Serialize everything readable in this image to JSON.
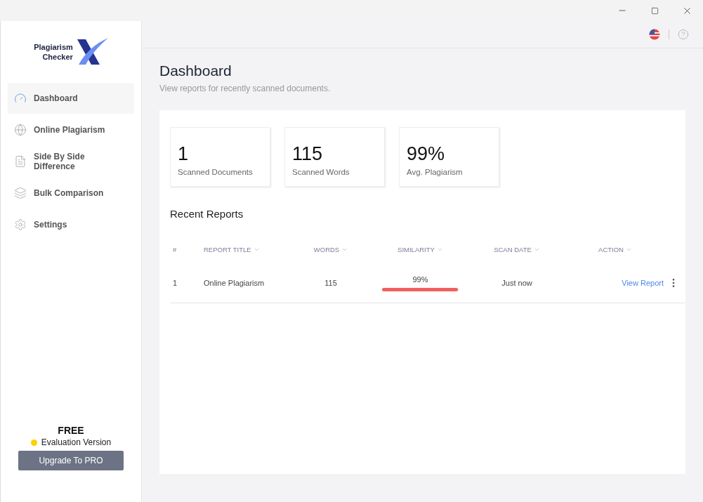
{
  "logo": {
    "line_1": "Plagiarism",
    "line_2": "Checker"
  },
  "sidebar": {
    "items": [
      {
        "label": "Dashboard",
        "kind": "gauge",
        "selected": true
      },
      {
        "label": "Online Plagiarism",
        "kind": "globe",
        "selected": false
      },
      {
        "label": "Side By Side Difference",
        "kind": "document",
        "selected": false
      },
      {
        "label": "Bulk Comparison",
        "kind": "layers",
        "selected": false
      },
      {
        "label": "Settings",
        "kind": "gear",
        "selected": false
      }
    ],
    "plan": "FREE",
    "license": {
      "label": "Evaluation Version",
      "color": "#ffd000"
    },
    "upgrade_button": "Upgrade To PRO"
  },
  "page": {
    "title": "Dashboard",
    "subtitle": "View reports for recently scanned documents."
  },
  "stats": [
    {
      "value": "1",
      "label": "Scanned Documents"
    },
    {
      "value": "115",
      "label": "Scanned Words"
    },
    {
      "value": "99%",
      "label": "Avg. Plagiarism"
    }
  ],
  "table": {
    "title": "Recent Reports",
    "columns": [
      {
        "label": "#",
        "sortable": false
      },
      {
        "label": "REPORT TITLE",
        "sortable": true
      },
      {
        "label": "WORDS",
        "sortable": true
      },
      {
        "label": "SIMILARITY",
        "sortable": true
      },
      {
        "label": "SCAN DATE",
        "sortable": true
      },
      {
        "label": "ACTION",
        "sortable": true
      }
    ],
    "rows": [
      {
        "index": "1",
        "title": "Online Plagiarism",
        "words": "115",
        "similarity": "99%",
        "level": 0.99,
        "date": "Just now",
        "action": "View Report"
      }
    ]
  }
}
